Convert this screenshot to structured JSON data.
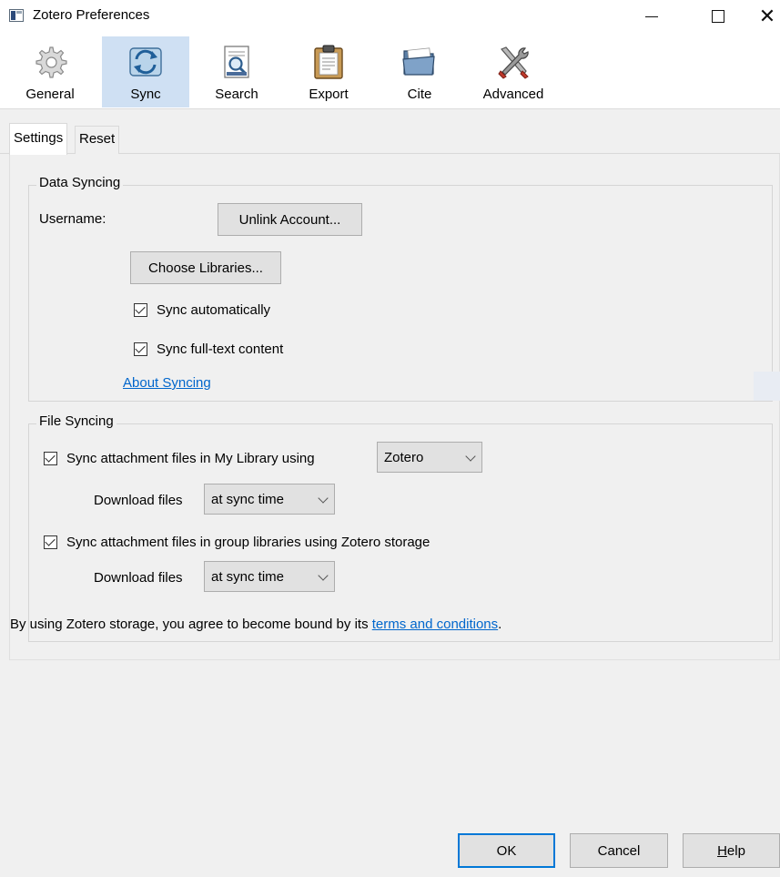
{
  "window": {
    "title": "Zotero Preferences",
    "controls": {
      "minimize": "minimize",
      "maximize": "maximize",
      "close": "✕"
    }
  },
  "toolbar": {
    "panes": [
      {
        "label": "General",
        "icon": "gear-icon"
      },
      {
        "label": "Sync",
        "icon": "sync-icon",
        "selected": true
      },
      {
        "label": "Search",
        "icon": "search-document-icon"
      },
      {
        "label": "Export",
        "icon": "clipboard-icon"
      },
      {
        "label": "Cite",
        "icon": "folder-icon"
      },
      {
        "label": "Advanced",
        "icon": "tools-icon"
      }
    ]
  },
  "tabs": [
    {
      "label": "Settings",
      "active": true
    },
    {
      "label": "Reset",
      "active": false
    }
  ],
  "data_syncing": {
    "caption": "Data Syncing",
    "username_label": "Username:",
    "unlink_button": "Unlink Account...",
    "choose_libraries_button": "Choose Libraries...",
    "sync_automatically": {
      "label": "Sync automatically",
      "checked": true
    },
    "sync_fulltext": {
      "label": "Sync full-text content",
      "checked": true
    },
    "about_link": "About Syncing"
  },
  "file_syncing": {
    "caption": "File Syncing",
    "my_library": {
      "label": "Sync attachment files in My Library using",
      "checked": true,
      "storage_value": "Zotero",
      "download_label": "Download files",
      "download_value": "at sync time"
    },
    "group_libraries": {
      "label": "Sync attachment files in group libraries using Zotero storage",
      "checked": true,
      "download_label": "Download files",
      "download_value": "at sync time"
    },
    "terms_prefix": "By using Zotero storage, you agree to become bound by its ",
    "terms_link": "terms and conditions",
    "terms_suffix": "."
  },
  "dialog_buttons": {
    "ok": "OK",
    "cancel": "Cancel",
    "help_mnemonic": "H",
    "help_rest": "elp"
  },
  "colors": {
    "selected_pane": "#cfe0f3",
    "link": "#0066cc",
    "default_button_border": "#0078d7"
  }
}
